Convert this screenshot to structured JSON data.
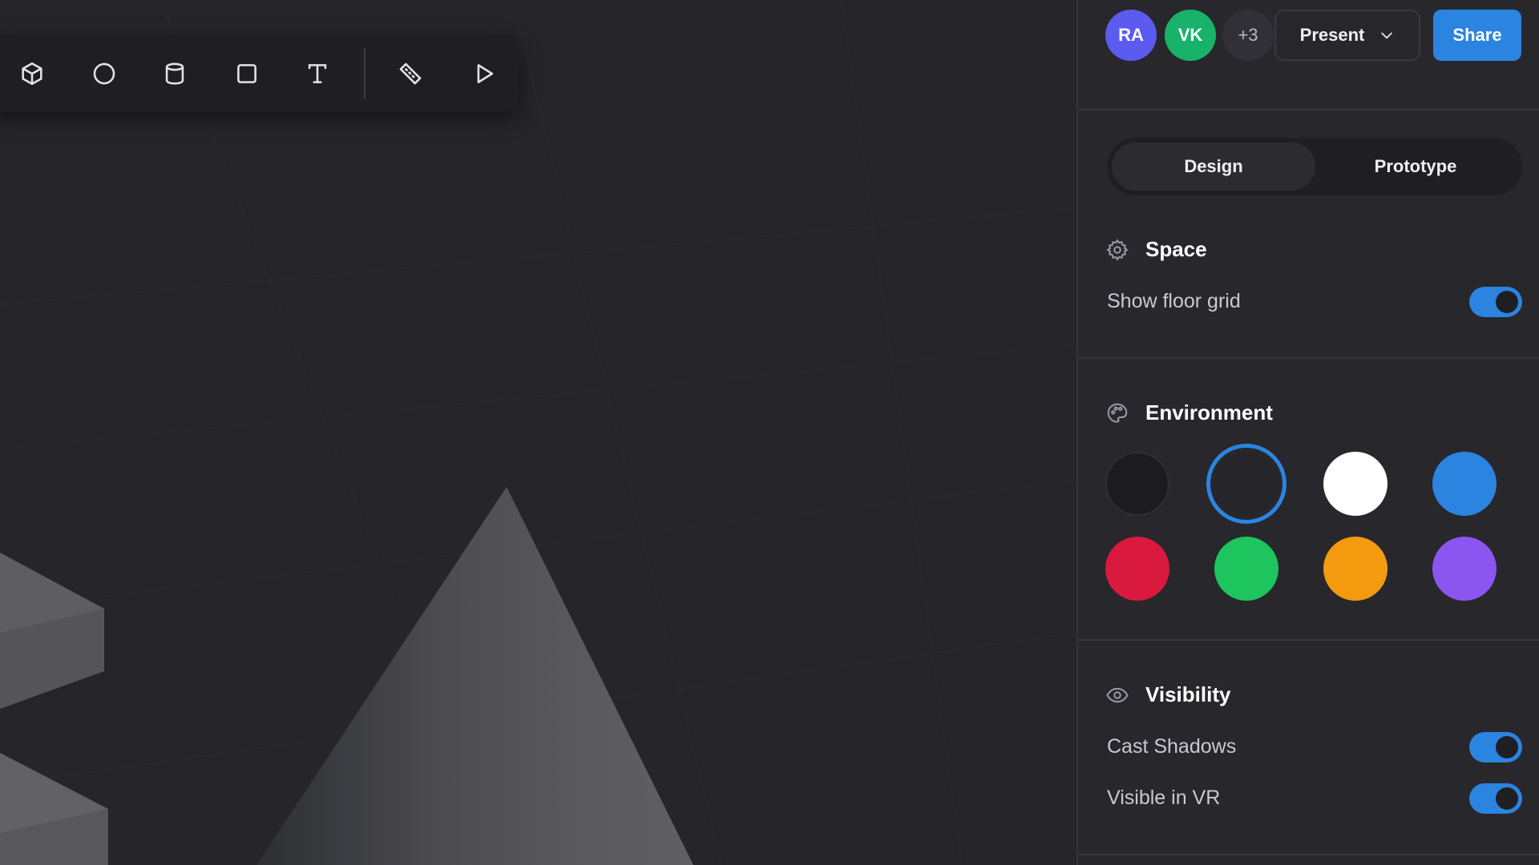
{
  "toolbar": {
    "tools": [
      {
        "name": "cube-icon"
      },
      {
        "name": "sphere-icon"
      },
      {
        "name": "cylinder-icon"
      },
      {
        "name": "plane-icon"
      },
      {
        "name": "text-icon"
      },
      {
        "name": "measure-icon"
      },
      {
        "name": "play-icon"
      }
    ]
  },
  "header": {
    "collaborators": [
      {
        "initials": "RA",
        "color": "#5b5bf0"
      },
      {
        "initials": "VK",
        "color": "#18b26b"
      }
    ],
    "more_count": "+3",
    "present_label": "Present",
    "share_label": "Share"
  },
  "tabs": [
    {
      "label": "Design",
      "active": true
    },
    {
      "label": "Prototype",
      "active": false
    }
  ],
  "space": {
    "title": "Space",
    "icon": "gear-icon",
    "show_floor_grid_label": "Show floor grid",
    "show_floor_grid": true
  },
  "environment": {
    "title": "Environment",
    "icon": "palette-icon",
    "swatches": [
      {
        "color": "#1c1c20",
        "selected": false
      },
      {
        "color": "#25252a",
        "selected": true
      },
      {
        "color": "#ffffff",
        "selected": false
      },
      {
        "color": "#2b84e0",
        "selected": false
      },
      {
        "color": "#d91a3e",
        "selected": false
      },
      {
        "color": "#1ec45e",
        "selected": false
      },
      {
        "color": "#f39a0f",
        "selected": false
      },
      {
        "color": "#8b55f0",
        "selected": false
      }
    ]
  },
  "visibility": {
    "title": "Visibility",
    "icon": "eye-icon",
    "cast_shadows_label": "Cast Shadows",
    "cast_shadows": true,
    "visible_in_vr_label": "Visible in VR",
    "visible_in_vr": true
  },
  "colors": {
    "accent": "#2b84e0",
    "canvas": "#25252a",
    "panel": "#27272c"
  }
}
